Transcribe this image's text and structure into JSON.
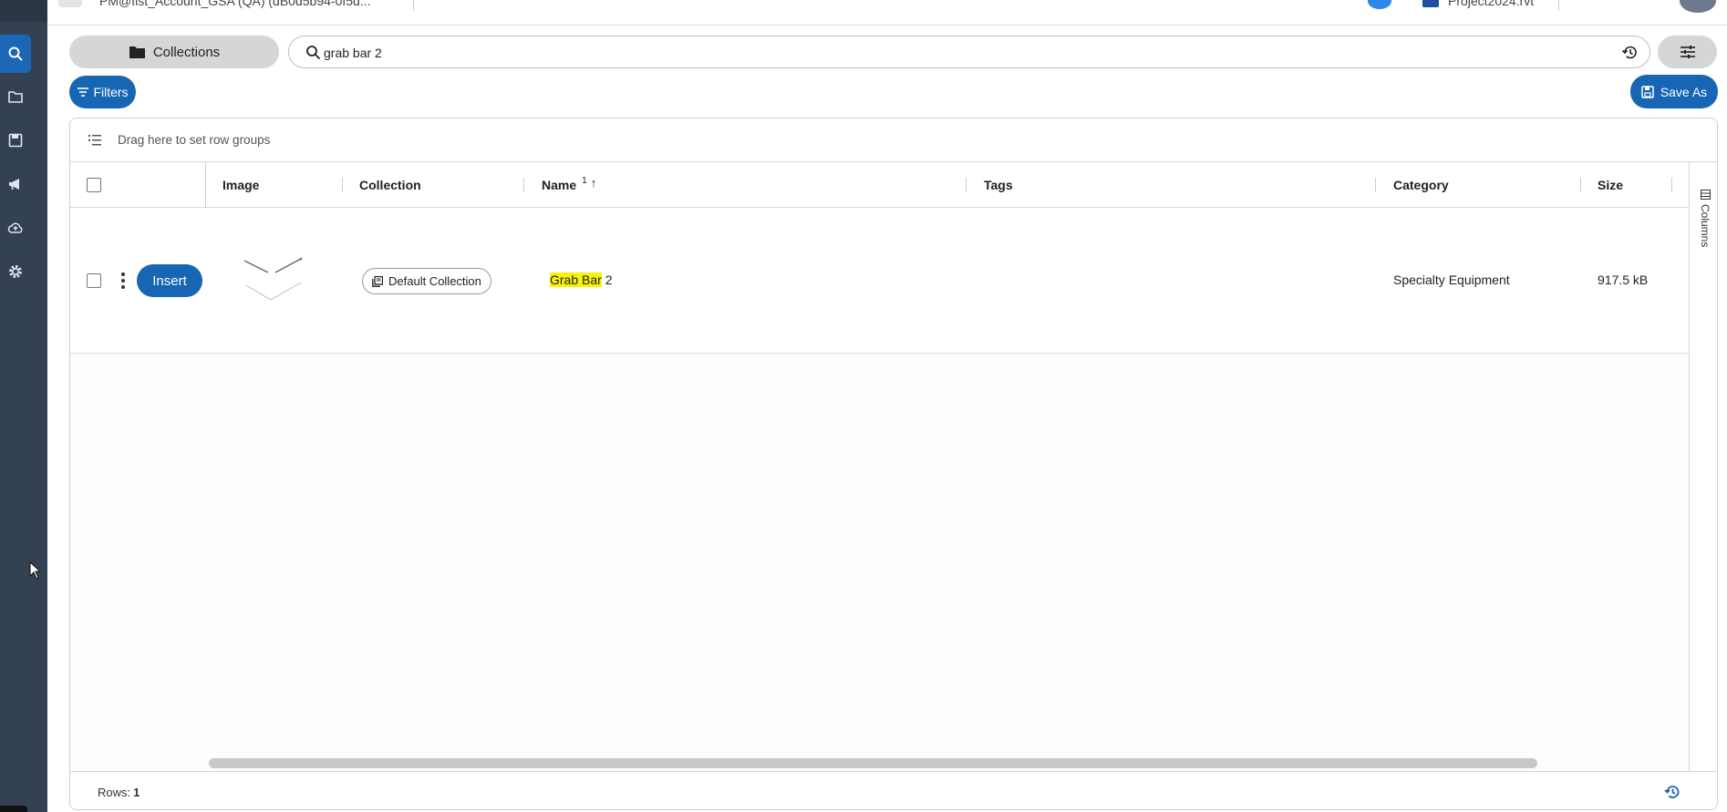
{
  "topbar": {
    "tab_text": "PM@fist_Account_GSA (QA) (dB0d5b94-0f5d...",
    "project": "Project2024.rvt"
  },
  "toolbar": {
    "collections_label": "Collections",
    "search_value": "grab bar 2",
    "filters_label": "Filters",
    "save_as_label": "Save As"
  },
  "grid": {
    "group_hint": "Drag here to set row groups",
    "headers": {
      "image": "Image",
      "collection": "Collection",
      "name": "Name",
      "name_sort_index": "1",
      "name_sort_arrow": "↑",
      "tags": "Tags",
      "category": "Category",
      "size": "Size"
    },
    "rows": [
      {
        "insert_label": "Insert",
        "collection": "Default Collection",
        "name_highlight": "Grab Bar",
        "name_rest": " 2",
        "tags": "",
        "category": "Specialty Equipment",
        "size": "917.5 kB"
      }
    ],
    "columns_panel_label": "Columns",
    "footer": {
      "rows_label": "Rows:",
      "rows_value": "1"
    }
  },
  "colors": {
    "rail": "#334152",
    "accent": "#1766b3",
    "highlight": "#f8f20a"
  },
  "icons": {
    "rail": [
      "search-icon",
      "folder-icon",
      "save-icon",
      "megaphone-icon",
      "cloud-upload-icon",
      "gear-icon"
    ]
  }
}
